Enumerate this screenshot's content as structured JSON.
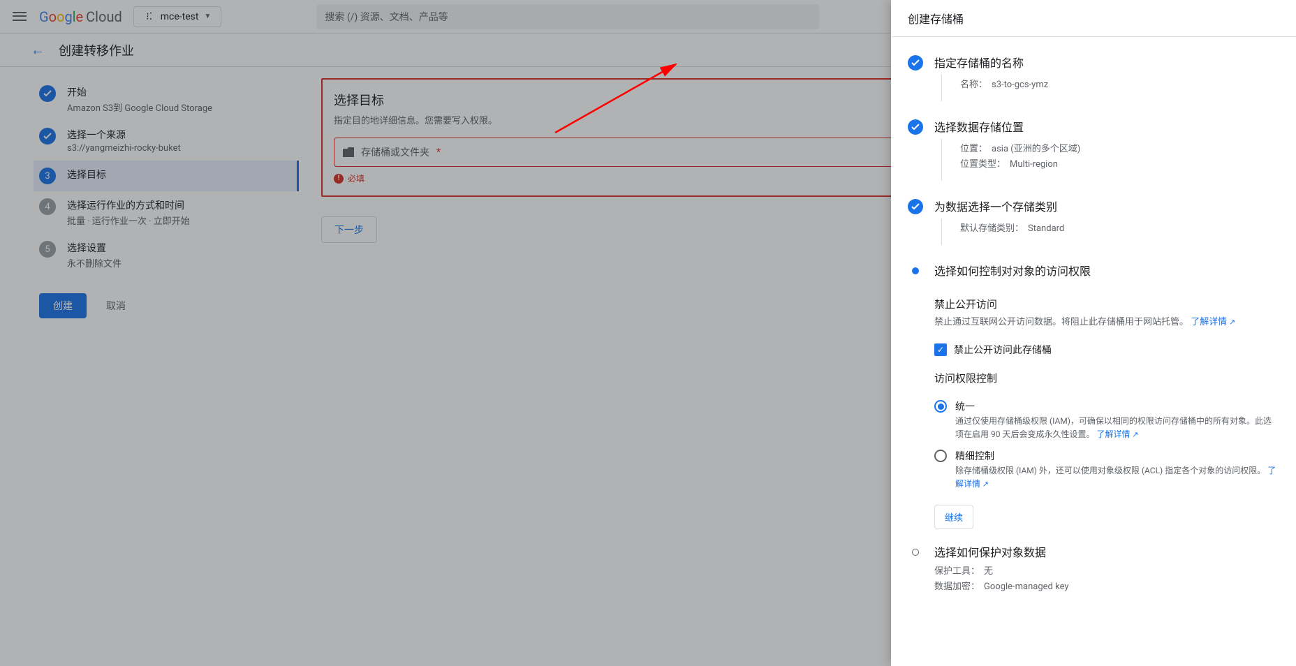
{
  "header": {
    "logo_text": "Google Cloud",
    "project": "mce-test",
    "search_placeholder": "搜索 (/) 资源、文档、产品等"
  },
  "page": {
    "title": "创建转移作业"
  },
  "steps": [
    {
      "title": "开始",
      "sub": "Amazon S3到 Google Cloud Storage",
      "state": "done",
      "num": "✓"
    },
    {
      "title": "选择一个来源",
      "sub": "s3://yangmeizhi-rocky-buket",
      "state": "done",
      "num": "✓"
    },
    {
      "title": "选择目标",
      "sub": "",
      "state": "current",
      "num": "3"
    },
    {
      "title": "选择运行作业的方式和时间",
      "sub": "批量 · 运行作业一次 · 立即开始",
      "state": "pending",
      "num": "4"
    },
    {
      "title": "选择设置",
      "sub": "永不删除文件",
      "state": "pending",
      "num": "5"
    }
  ],
  "actions": {
    "create": "创建",
    "cancel": "取消"
  },
  "dest": {
    "title": "选择目标",
    "desc": "指定目的地详细信息。您需要写入权限。",
    "placeholder": "存储桶或文件夹",
    "required": "必填",
    "next": "下一步"
  },
  "drawer": {
    "title": "创建存储桶",
    "s1": {
      "title": "指定存储桶的名称",
      "name_label": "名称：",
      "name_value": "s3-to-gcs-ymz"
    },
    "s2": {
      "title": "选择数据存储位置",
      "loc_label": "位置：",
      "loc_value": "asia (亚洲的多个区域)",
      "type_label": "位置类型：",
      "type_value": "Multi-region"
    },
    "s3": {
      "title": "为数据选择一个存储类别",
      "cls_label": "默认存储类别：",
      "cls_value": "Standard"
    },
    "s4": {
      "title": "选择如何控制对对象的访问权限",
      "pub_title": "禁止公开访问",
      "pub_desc": "禁止通过互联网公开访问数据。将阻止此存储桶用于网站托管。",
      "learn": "了解详情",
      "chk_label": "禁止公开访问此存储桶",
      "acl_title": "访问权限控制",
      "r1_label": "统一",
      "r1_desc_a": "通过仅使用存储桶级权限 (IAM)，可确保以相同的权限访问存储桶中的所有对象。此选项在启用 90 天后会变成永久性设置。",
      "r2_label": "精细控制",
      "r2_desc": "除存储桶级权限 (IAM) 外，还可以使用对象级权限 (ACL) 指定各个对象的访问权限。",
      "continue": "继续"
    },
    "s5": {
      "title": "选择如何保护对象数据",
      "tool_label": "保护工具：",
      "tool_value": "无",
      "enc_label": "数据加密：",
      "enc_value": "Google-managed key"
    }
  }
}
